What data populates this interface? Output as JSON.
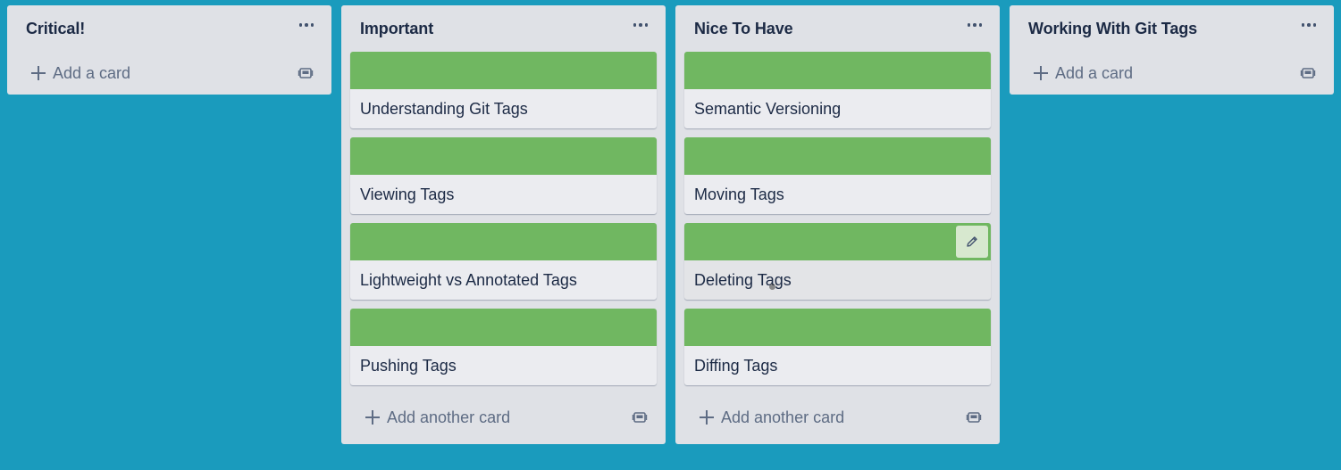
{
  "colors": {
    "board_background": "#1a9bbd",
    "list_background": "#dfe1e6",
    "card_background": "#ebecf0",
    "card_cover": "#70b761"
  },
  "lists": [
    {
      "title": "Critical!",
      "cards": [],
      "add_label": "Add a card"
    },
    {
      "title": "Important",
      "cards": [
        {
          "title": "Understanding Git Tags"
        },
        {
          "title": "Viewing Tags"
        },
        {
          "title": "Lightweight vs Annotated Tags"
        },
        {
          "title": "Pushing Tags"
        }
      ],
      "add_label": "Add another card"
    },
    {
      "title": "Nice To Have",
      "cards": [
        {
          "title": "Semantic Versioning"
        },
        {
          "title": "Moving Tags"
        },
        {
          "title": "Deleting Tags"
        },
        {
          "title": "Diffing Tags"
        }
      ],
      "add_label": "Add another card"
    },
    {
      "title": "Working With Git Tags",
      "cards": [],
      "add_label": "Add a card"
    }
  ],
  "icons": {
    "list_menu": "more-horizontal-icon",
    "add": "plus-icon",
    "template": "card-template-icon",
    "edit": "pencil-icon"
  }
}
